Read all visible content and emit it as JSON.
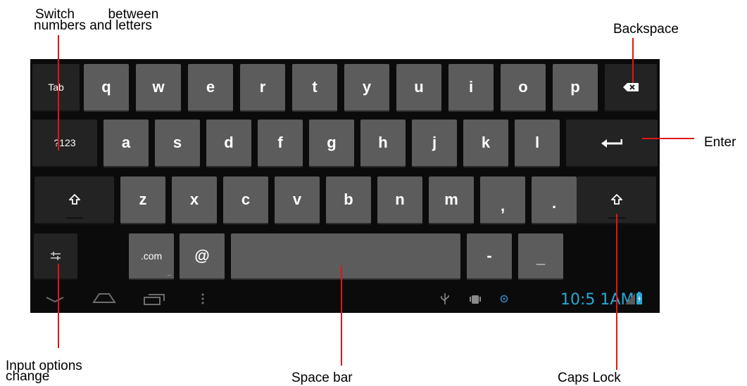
{
  "annotations": {
    "switch_line1": "Switch         between",
    "switch_line2": "numbers and letters",
    "backspace": "Backspace",
    "enter": "Enter",
    "input_options_line1": "Input options",
    "input_options_line2": "change",
    "space_bar": "Space bar",
    "caps_lock": "Caps Lock"
  },
  "keyboard": {
    "row1": [
      "Tab",
      "q",
      "w",
      "e",
      "r",
      "t",
      "y",
      "u",
      "i",
      "o",
      "p"
    ],
    "row2": [
      "?123",
      "a",
      "s",
      "d",
      "f",
      "g",
      "h",
      "j",
      "k",
      "l"
    ],
    "row3": [
      "z",
      "x",
      "c",
      "v",
      "b",
      "n",
      "m",
      ",",
      "."
    ],
    "row4": {
      "dotcom": ".com",
      "dotcom_more": "...",
      "at": "@",
      "dash": "-",
      "underscore": "_"
    }
  },
  "icons": {
    "backspace": "backspace-icon",
    "enter": "enter-arrow-icon",
    "shift": "shift-arrow-icon",
    "settings": "input-options-icon"
  },
  "status_bar": {
    "time": "10:5 1AM",
    "time_color": "#29a8d6"
  },
  "colors": {
    "annotation_line": "#e01515",
    "key_light": "#5c5c5c",
    "key_dark": "#232323"
  }
}
